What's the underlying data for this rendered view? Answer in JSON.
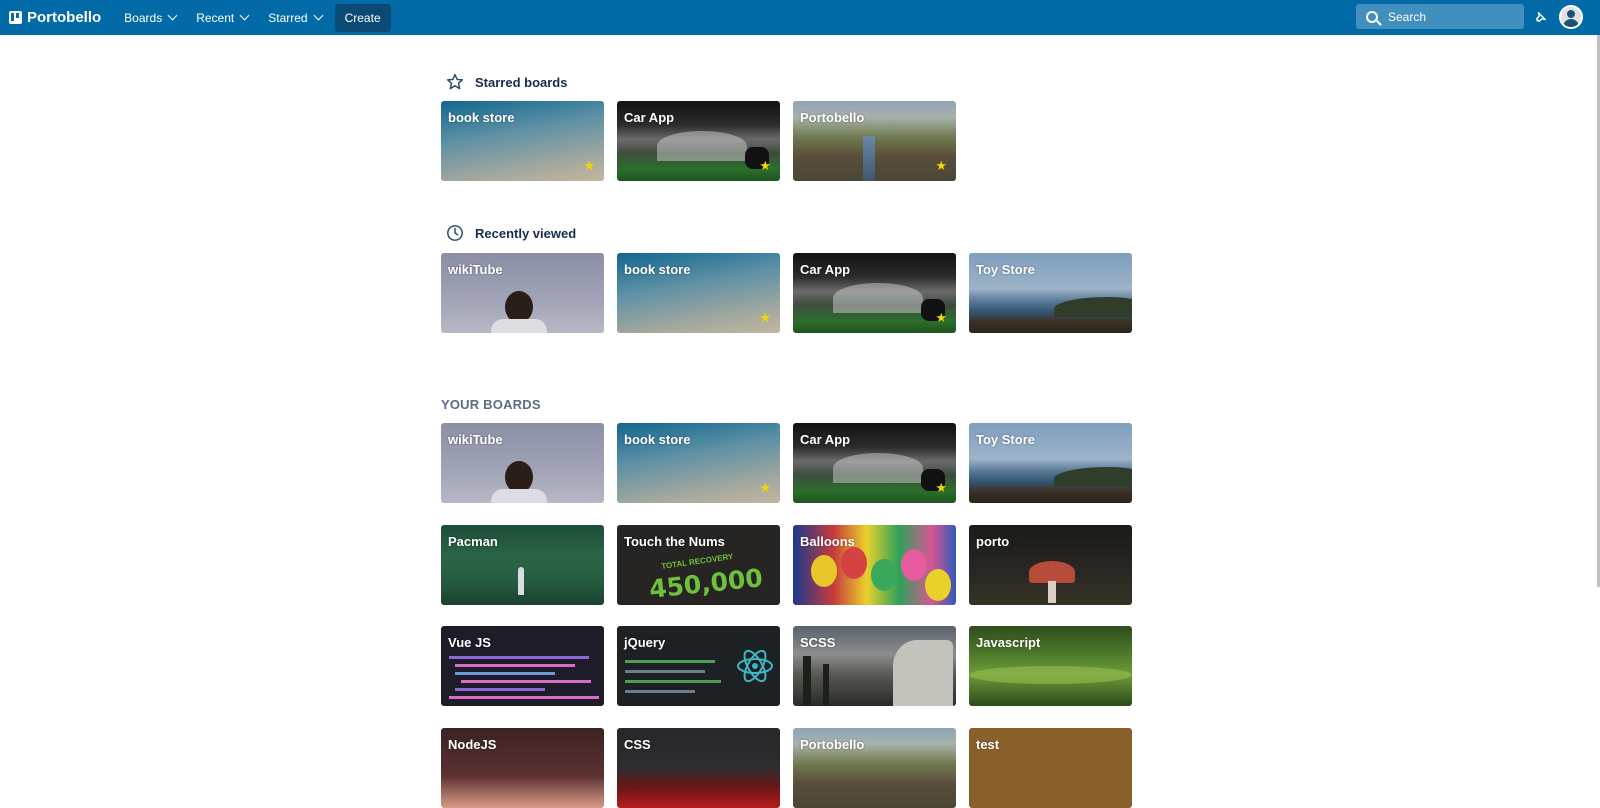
{
  "topbar": {
    "brand": "Portobello",
    "nav": [
      "Boards",
      "Recent",
      "Starred"
    ],
    "create_label": "Create",
    "search_placeholder": "Search",
    "bg_color": "#026aa7"
  },
  "starred": {
    "heading": "Starred boards",
    "icon": "star-outline-icon",
    "boards": [
      {
        "name": "book store",
        "starred": true
      },
      {
        "name": "Car App",
        "starred": true
      },
      {
        "name": "Portobello",
        "starred": true
      }
    ]
  },
  "recent": {
    "heading": "Recently viewed",
    "icon": "clock-icon",
    "boards": [
      {
        "name": "wikiTube",
        "starred": false
      },
      {
        "name": "book store",
        "starred": true
      },
      {
        "name": "Car App",
        "starred": true
      },
      {
        "name": "Toy Store",
        "starred": false
      }
    ]
  },
  "your_boards": {
    "heading": "YOUR BOARDS",
    "boards": [
      {
        "name": "wikiTube",
        "starred": false
      },
      {
        "name": "book store",
        "starred": true
      },
      {
        "name": "Car App",
        "starred": true
      },
      {
        "name": "Toy Store",
        "starred": false
      },
      {
        "name": "Pacman",
        "starred": false
      },
      {
        "name": "Touch the Nums",
        "starred": false
      },
      {
        "name": "Balloons",
        "starred": false
      },
      {
        "name": "porto",
        "starred": false
      },
      {
        "name": "Vue JS",
        "starred": false
      },
      {
        "name": "jQuery",
        "starred": false
      },
      {
        "name": "SCSS",
        "starred": false
      },
      {
        "name": "Javascript",
        "starred": false
      },
      {
        "name": "NodeJS",
        "starred": false
      },
      {
        "name": "CSS",
        "starred": false
      },
      {
        "name": "Portobello",
        "starred": false
      },
      {
        "name": "test",
        "starred": false
      }
    ]
  },
  "touch_nums_image": {
    "line1": "TOTAL RECOVERY",
    "line2": "450,000"
  },
  "star_glyph": "★",
  "colors": {
    "star": "#f2d600",
    "heading": "#172b4d",
    "muted": "#5e6c84"
  }
}
